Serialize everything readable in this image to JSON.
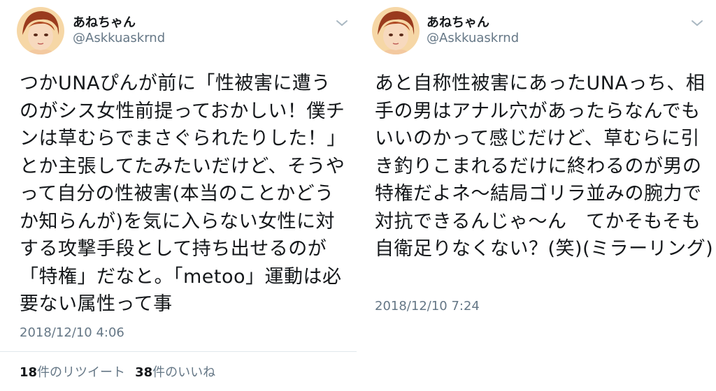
{
  "left_tweet": {
    "display_name": "あねちゃん",
    "handle": "@Askkuaskrnd",
    "text": "つかUNAぴんが前に「性被害に遭うのがシス女性前提っておかしい！僕チンは草むらでまさぐられたりした！」とか主張してたみたいだけど、そうやって自分の性被害(本当のことかどうか知らんが)を気に入らない女性に対する攻撃手段として持ち出せるのが「特権」だなと。「metoo」運動は必要ない属性って事",
    "timestamp": "2018/12/10 4:06",
    "retweets_count": "18",
    "retweets_label": "件のリツイート",
    "likes_count": "38",
    "likes_label": "件のいいね"
  },
  "right_tweet": {
    "display_name": "あねちゃん",
    "handle": "@Askkuaskrnd",
    "text": "あと自称性被害にあったUNAっち、相手の男はアナル穴があったらなんでもいいのかって感じだけど、草むらに引き釣りこまれるだけに終わるのが男の特権だよネ〜結局ゴリラ並みの腕力で対抗できるんじゃ〜ん　てかそもそも自衛足りなくない？(笑)(ミラーリング)",
    "timestamp": "2018/12/10 7:24"
  },
  "icons": {
    "avatar": "avatar-image",
    "caret": "chevron-down-icon"
  },
  "colors": {
    "text_primary": "#14171a",
    "text_secondary": "#657786",
    "divider": "#e1e8ed"
  }
}
